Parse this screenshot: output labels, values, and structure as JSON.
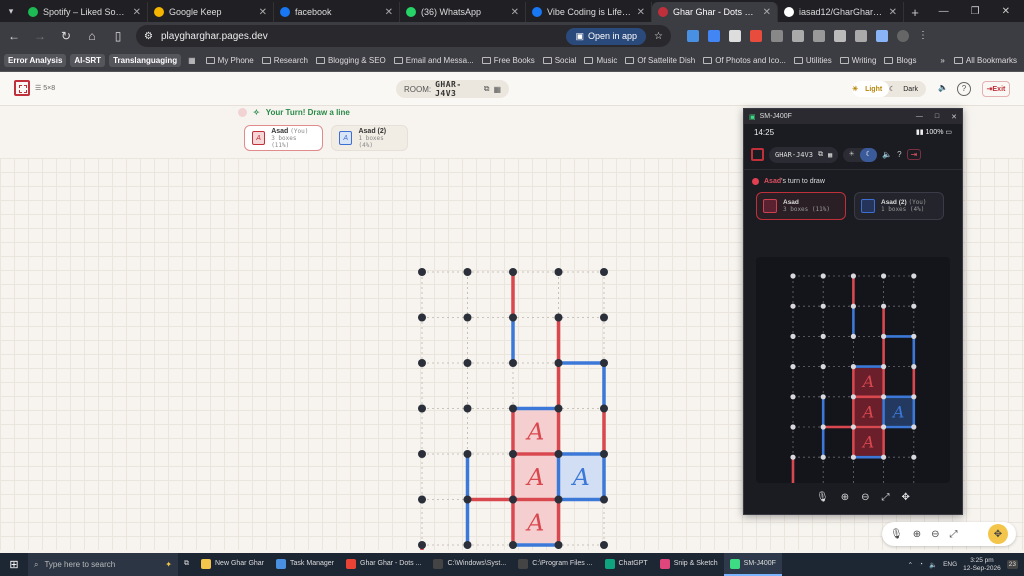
{
  "browser": {
    "tabs": [
      {
        "title": "Spotify – Liked Songs",
        "color": "#1db954"
      },
      {
        "title": "Google Keep",
        "color": "#f4b400"
      },
      {
        "title": "facebook",
        "color": "#1877f2"
      },
      {
        "title": "(36) WhatsApp",
        "color": "#25d366"
      },
      {
        "title": "Vibe Coding is Life | Facebo",
        "color": "#1877f2"
      },
      {
        "title": "Ghar Ghar - Dots & Boxes M",
        "color": "#c0303a"
      },
      {
        "title": "iasad12/GharGharOnline: A",
        "color": "#ffffff"
      }
    ],
    "url": "playgharghar.pages.dev",
    "open_in_app": "Open in app",
    "bookmarks": {
      "chips": [
        "Error Analysis",
        "AI-SRT",
        "Translanguaging"
      ],
      "folders": [
        "My Phone",
        "Research",
        "Blogging & SEO",
        "Email and Messa...",
        "Free Books",
        "Social",
        "Music",
        "Of Sattelite Dish",
        "Of Photos and Ico...",
        "Utilities",
        "Writing",
        "Blogs"
      ],
      "all": "All Bookmarks"
    }
  },
  "app": {
    "grid_size": "5×8",
    "room_label": "ROOM:",
    "room_code": "GHAR-J4V3",
    "theme_light": "Light",
    "theme_dark": "Dark",
    "exit": "Exit",
    "turn_message": "Your Turn! Draw a line",
    "players": [
      {
        "name": "Asad",
        "tag": "(You)",
        "boxes": "3 boxes (11%)",
        "letter": "A"
      },
      {
        "name": "Asad (2)",
        "tag": "",
        "boxes": "1 boxes (4%)",
        "letter": "A"
      }
    ]
  },
  "board": {
    "cols": 5,
    "rows": 8,
    "colors": {
      "p1": "#d9474f",
      "p2": "#3b78d8",
      "dot": "#2a2f3a",
      "p1_fill": "#f5cfcf",
      "p2_fill": "#d2def3"
    },
    "lines": [
      {
        "a": [
          2,
          0
        ],
        "b": [
          2,
          1
        ],
        "p": 1
      },
      {
        "a": [
          2,
          1
        ],
        "b": [
          2,
          2
        ],
        "p": 2
      },
      {
        "a": [
          3,
          1
        ],
        "b": [
          3,
          2
        ],
        "p": 1
      },
      {
        "a": [
          3,
          2
        ],
        "b": [
          4,
          2
        ],
        "p": 2
      },
      {
        "a": [
          4,
          2
        ],
        "b": [
          4,
          3
        ],
        "p": 2
      },
      {
        "a": [
          3,
          2
        ],
        "b": [
          3,
          3
        ],
        "p": 1
      },
      {
        "a": [
          4,
          3
        ],
        "b": [
          4,
          4
        ],
        "p": 1
      },
      {
        "a": [
          2,
          3
        ],
        "b": [
          3,
          3
        ],
        "p": 2
      },
      {
        "a": [
          2,
          3
        ],
        "b": [
          2,
          4
        ],
        "p": 1
      },
      {
        "a": [
          3,
          3
        ],
        "b": [
          3,
          4
        ],
        "p": 1
      },
      {
        "a": [
          2,
          4
        ],
        "b": [
          3,
          4
        ],
        "p": 1
      },
      {
        "a": [
          3,
          4
        ],
        "b": [
          4,
          4
        ],
        "p": 2
      },
      {
        "a": [
          2,
          4
        ],
        "b": [
          2,
          5
        ],
        "p": 1
      },
      {
        "a": [
          3,
          4
        ],
        "b": [
          3,
          5
        ],
        "p": 2
      },
      {
        "a": [
          4,
          4
        ],
        "b": [
          4,
          5
        ],
        "p": 2
      },
      {
        "a": [
          2,
          5
        ],
        "b": [
          3,
          5
        ],
        "p": 1
      },
      {
        "a": [
          3,
          5
        ],
        "b": [
          4,
          5
        ],
        "p": 2
      },
      {
        "a": [
          1,
          4
        ],
        "b": [
          1,
          5
        ],
        "p": 2
      },
      {
        "a": [
          1,
          5
        ],
        "b": [
          1,
          6
        ],
        "p": 2
      },
      {
        "a": [
          1,
          5
        ],
        "b": [
          2,
          5
        ],
        "p": 1
      },
      {
        "a": [
          2,
          5
        ],
        "b": [
          2,
          6
        ],
        "p": 1
      },
      {
        "a": [
          3,
          5
        ],
        "b": [
          3,
          6
        ],
        "p": 1
      },
      {
        "a": [
          2,
          6
        ],
        "b": [
          3,
          6
        ],
        "p": 2
      },
      {
        "a": [
          0,
          6
        ],
        "b": [
          0,
          7
        ],
        "p": 1
      },
      {
        "a": [
          1,
          7
        ],
        "b": [
          2,
          7
        ],
        "p": 1
      }
    ],
    "boxes": [
      {
        "c": 2,
        "r": 3,
        "p": 1
      },
      {
        "c": 2,
        "r": 4,
        "p": 1
      },
      {
        "c": 3,
        "r": 4,
        "p": 2
      },
      {
        "c": 2,
        "r": 5,
        "p": 1
      }
    ]
  },
  "phone": {
    "window_title": "SM-J400F",
    "time": "14:25",
    "battery": "100%",
    "room_code": "GHAR-J4V3",
    "turn_name": "Asad",
    "turn_suffix": "'s turn to draw",
    "players": [
      {
        "name": "Asad",
        "tag": "",
        "boxes": "3 boxes (11%)"
      },
      {
        "name": "Asad (2)",
        "tag": "(You)",
        "boxes": "1 boxes (4%)"
      }
    ]
  },
  "taskbar": {
    "search_placeholder": "Type here to search",
    "apps": [
      "New Ghar Ghar",
      "Task Manager",
      "Ghar Ghar - Dots ...",
      "C:\\Windows\\Syst...",
      "C:\\Program Files ...",
      "ChatGPT",
      "Snip & Sketch",
      "SM-J400F"
    ],
    "lang": "ENG",
    "time": "3:25 pm",
    "date": "12-Sep-2026",
    "badge": "23"
  }
}
